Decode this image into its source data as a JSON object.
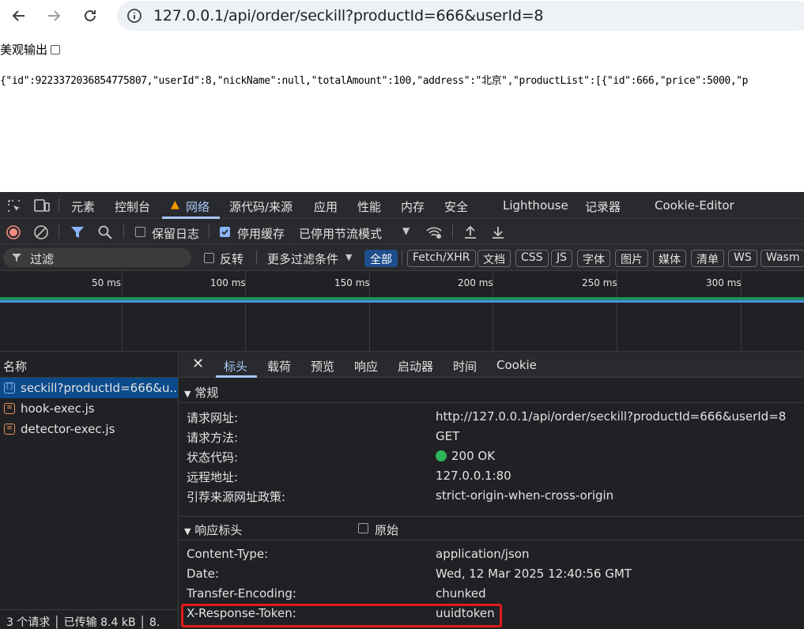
{
  "browser": {
    "url": "127.0.0.1/api/order/seckill?productId=666&userId=8"
  },
  "page": {
    "pretty_label": "美观输出",
    "json_text": "{\"id\":9223372036854775807,\"userId\":8,\"nickName\":null,\"totalAmount\":100,\"address\":\"北京\",\"productList\":[{\"id\":666,\"price\":5000,\"p"
  },
  "devtools": {
    "tabs": [
      "元素",
      "控制台",
      "网络",
      "源代码/来源",
      "应用",
      "性能",
      "内存",
      "安全",
      "Lighthouse",
      "记录器",
      "Cookie-Editor"
    ],
    "toolbar": {
      "preserve_log": "保留日志",
      "disable_cache": "停用缓存",
      "throttling": "已停用节流模式"
    },
    "filter": {
      "placeholder": "过滤",
      "invert": "反转",
      "more_filters": "更多过滤条件",
      "chips": [
        "全部",
        "Fetch/XHR",
        "文档",
        "CSS",
        "JS",
        "字体",
        "图片",
        "媒体",
        "清单",
        "WS",
        "Wasm"
      ]
    },
    "timeline": {
      "ticks": [
        "50 ms",
        "100 ms",
        "150 ms",
        "200 ms",
        "250 ms",
        "300 ms"
      ]
    },
    "requests": {
      "header": "名称",
      "items": [
        "seckill?productId=666&u...",
        "hook-exec.js",
        "detector-exec.js"
      ],
      "status_bar": "3 个请求 │ 已传输 8.4 kB │ 8."
    },
    "detail": {
      "tabs": [
        "标头",
        "载荷",
        "预览",
        "响应",
        "启动器",
        "时间",
        "Cookie"
      ],
      "general_title": "常规",
      "general": [
        {
          "k": "请求网址:",
          "v": "http://127.0.0.1/api/order/seckill?productId=666&userId=8"
        },
        {
          "k": "请求方法:",
          "v": "GET"
        },
        {
          "k": "状态代码:",
          "v": "200 OK"
        },
        {
          "k": "远程地址:",
          "v": "127.0.0.1:80"
        },
        {
          "k": "引荐来源网址政策:",
          "v": "strict-origin-when-cross-origin"
        }
      ],
      "response_title": "响应标头",
      "raw_label": "原始",
      "response": [
        {
          "k": "Content-Type:",
          "v": "application/json"
        },
        {
          "k": "Date:",
          "v": "Wed, 12 Mar 2025 12:40:56 GMT"
        },
        {
          "k": "Transfer-Encoding:",
          "v": "chunked"
        },
        {
          "k": "X-Response-Token:",
          "v": "uuidtoken"
        }
      ]
    },
    "colors": {
      "accent": "#a8c7fa",
      "status_ok": "#2fb45a",
      "highlight": "#e01b1b"
    }
  }
}
